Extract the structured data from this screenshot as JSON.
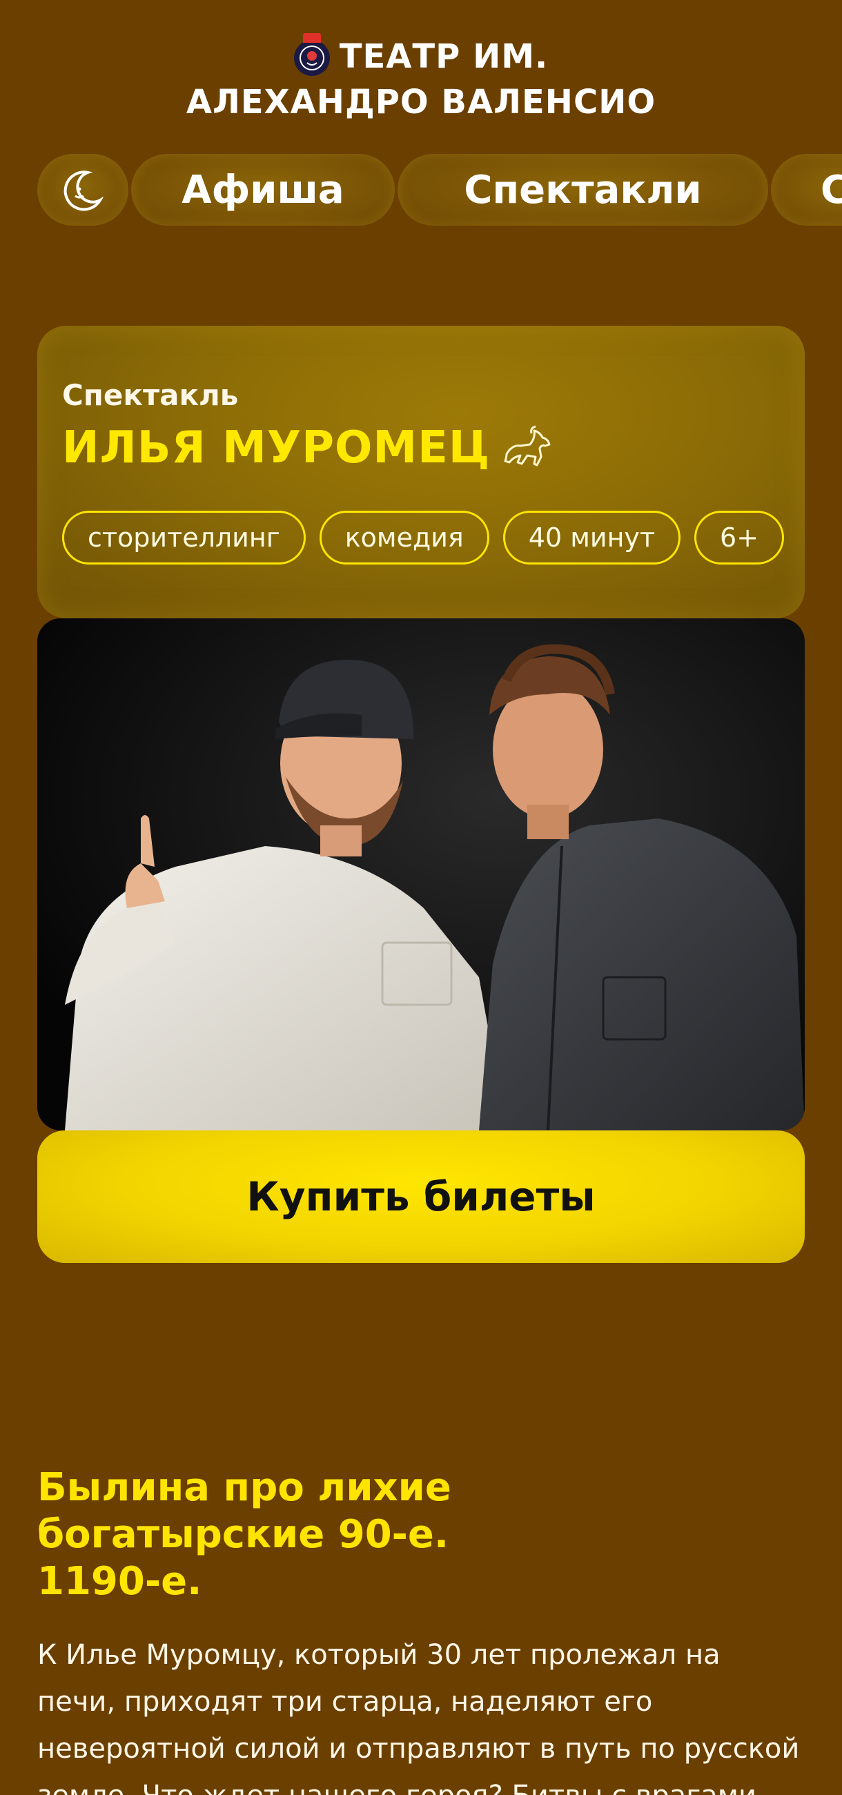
{
  "header": {
    "brand_line1": "ТЕАТР ИМ.",
    "brand_line2": "АЛЕХАНДРО ВАЛЕНСИО",
    "logo_icon": "theatre-badge-icon"
  },
  "nav": {
    "items": [
      {
        "label": "",
        "icon": "moon-icon"
      },
      {
        "label": "Афиша"
      },
      {
        "label": "Спектакли"
      },
      {
        "label": "С"
      }
    ]
  },
  "show": {
    "kind": "Спектакль",
    "title": "ИЛЬЯ МУРОМЕЦ",
    "title_icon": "horse-icon",
    "tags": [
      "сторителлинг",
      "комедия",
      "40 минут",
      "6+"
    ]
  },
  "cta": {
    "buy_label": "Купить билеты"
  },
  "description": {
    "heading_lines": [
      "Былина про лихие",
      "богатырские 90-е.",
      "1190-е."
    ],
    "text": "К Илье Муромцу, который 30 лет пролежал на печи, приходят три старца, наделяют его невероятной силой и отправляют в путь по русской земле. Что ждет нашего героя? Битвы с врагами, скачки"
  },
  "colors": {
    "background": "#6b3f00",
    "accent_yellow": "#ffe800",
    "pill": "#7a5406"
  }
}
